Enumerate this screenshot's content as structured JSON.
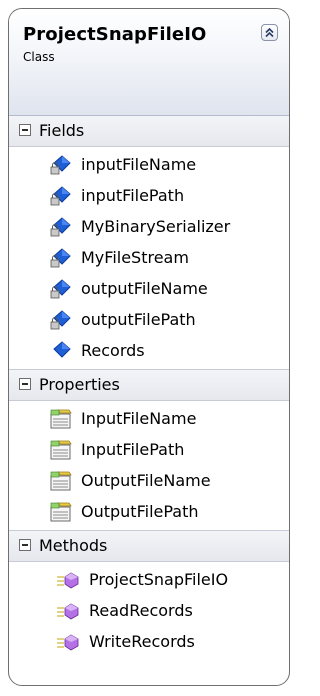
{
  "class": {
    "name": "ProjectSnapFileIO",
    "stereotype": "Class",
    "collapse_icon": "double-chevron-up-icon"
  },
  "fields": {
    "title": "Fields",
    "items": [
      {
        "label": "inputFileName",
        "icon": "private-field-icon"
      },
      {
        "label": "inputFilePath",
        "icon": "private-field-icon"
      },
      {
        "label": "MyBinarySerializer",
        "icon": "private-field-icon"
      },
      {
        "label": "MyFileStream",
        "icon": "private-field-icon"
      },
      {
        "label": "outputFileName",
        "icon": "private-field-icon"
      },
      {
        "label": "outputFilePath",
        "icon": "private-field-icon"
      },
      {
        "label": "Records",
        "icon": "public-field-icon"
      }
    ]
  },
  "properties": {
    "title": "Properties",
    "items": [
      {
        "label": "InputFileName",
        "icon": "property-icon"
      },
      {
        "label": "InputFilePath",
        "icon": "property-icon"
      },
      {
        "label": "OutputFileName",
        "icon": "property-icon"
      },
      {
        "label": "OutputFilePath",
        "icon": "property-icon"
      }
    ]
  },
  "methods": {
    "title": "Methods",
    "items": [
      {
        "label": "ProjectSnapFileIO",
        "icon": "method-icon"
      },
      {
        "label": "ReadRecords",
        "icon": "method-icon"
      },
      {
        "label": "WriteRecords",
        "icon": "method-icon"
      }
    ]
  },
  "colors": {
    "field_blue": "#1f5fd6",
    "property_yellow": "#e7c94a",
    "method_purple": "#9b4fd0",
    "header_gradient_end": "#dfe4ee",
    "border": "#6f6f6f"
  }
}
